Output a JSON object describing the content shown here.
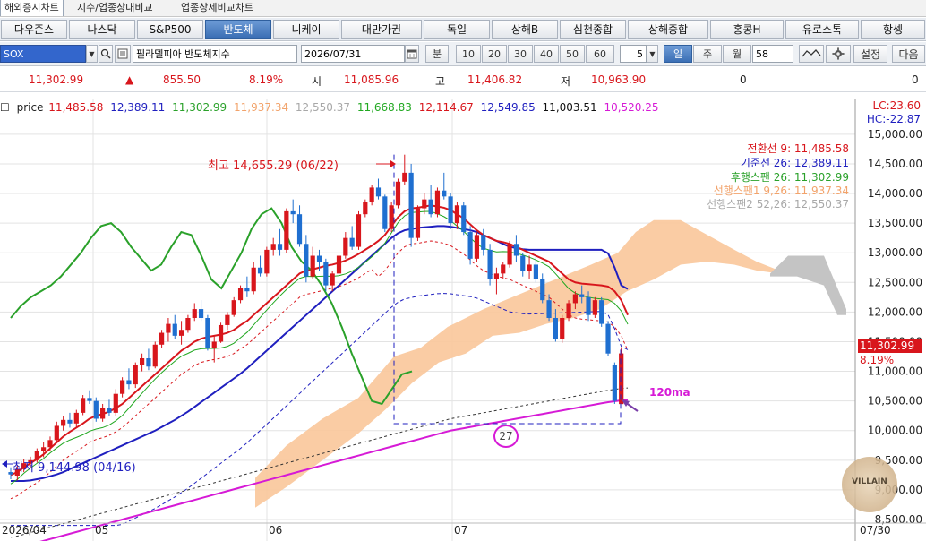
{
  "top_tabs": [
    "해외증시차트",
    "지수/업종상대비교",
    "업종상세비교차트"
  ],
  "markets": [
    "다우존스",
    "나스닥",
    "S&P500",
    "반도체",
    "니케이",
    "대만가권",
    "독일",
    "상해B",
    "심천종합",
    "상해종합",
    "홍콩H",
    "유로스톡",
    "항셍"
  ],
  "active_market": "반도체",
  "controls": {
    "code": "SOX",
    "name": "필라델피아 반도체지수",
    "date": "2026/07/31",
    "period_label": "분",
    "minute_options": [
      "10",
      "20",
      "30",
      "40",
      "50",
      "60"
    ],
    "minute_select": "5",
    "day_label": "일",
    "week_label": "주",
    "month_label": "월",
    "count_value": "58",
    "settings_label": "설정",
    "next_label": "다음"
  },
  "price_row": {
    "current": "11,302.99",
    "arrow": "▲",
    "change": "855.50",
    "change_pct": "8.19%",
    "open_label": "시",
    "open": "11,085.96",
    "high_label": "고",
    "high": "11,406.82",
    "low_label": "저",
    "low": "10,963.90",
    "vol1": "0",
    "vol2": "0"
  },
  "legend": {
    "label": "price",
    "values": [
      "11,485.58",
      "12,389.11",
      "11,302.99",
      "11,937.34",
      "12,550.37",
      "11,668.83",
      "12,114.67",
      "12,549.85",
      "11,003.51",
      "10,520.25"
    ],
    "colors": [
      "#d8161c",
      "#1f1fbf",
      "#2aa12a",
      "#f2a36b",
      "#a8a8a8",
      "#21a821",
      "#d8161c",
      "#1f1fbf",
      "#111111",
      "#d61ad6"
    ]
  },
  "lc_hc": {
    "lc": "LC:23.60",
    "hc": "HC:-22.87"
  },
  "ichimoku_labels": [
    {
      "text": "전환선 9: 11,485.58",
      "color": "#d8161c"
    },
    {
      "text": "기준선 26: 12,389.11",
      "color": "#1f1fbf"
    },
    {
      "text": "후행스팬 26: 11,302.99",
      "color": "#2aa12a"
    },
    {
      "text": "선행스팬1 9,26: 11,937.34",
      "color": "#f2a36b"
    },
    {
      "text": "선행스팬2 52,26: 12,550.37",
      "color": "#a8a8a8"
    }
  ],
  "annotations": {
    "high": "최고 14,655.29 (06/22)",
    "low": "최저 9,144.98 (04/16)",
    "count": "27",
    "ma": "120ma",
    "watermark": "VILLAIN"
  },
  "current_price_tag": {
    "price": "11,302.99",
    "pct": "8.19%"
  },
  "chart_data": {
    "type": "candlestick",
    "y_axis": {
      "ticks": [
        "15,000.00",
        "14,500.00",
        "14,000.00",
        "13,500.00",
        "13,000.00",
        "12,500.00",
        "12,000.00",
        "11,500.00",
        "11,000.00",
        "10,500.00",
        "10,000.00",
        "9,500.00",
        "9,000.00",
        "8,500.00"
      ],
      "range": [
        8500,
        15300
      ]
    },
    "x_axis": {
      "labels": [
        "2026/04",
        "05",
        "06",
        "07",
        "07/30"
      ]
    },
    "candles": [
      [
        9300,
        9380,
        9180,
        9260
      ],
      [
        9240,
        9420,
        9160,
        9350
      ],
      [
        9350,
        9520,
        9300,
        9450
      ],
      [
        9450,
        9560,
        9380,
        9500
      ],
      [
        9500,
        9700,
        9460,
        9650
      ],
      [
        9650,
        9800,
        9550,
        9720
      ],
      [
        9720,
        9900,
        9650,
        9840
      ],
      [
        9840,
        10150,
        9800,
        10080
      ],
      [
        10080,
        10250,
        10000,
        10180
      ],
      [
        10180,
        10300,
        10050,
        10120
      ],
      [
        10120,
        10350,
        10050,
        10300
      ],
      [
        10300,
        10600,
        10260,
        10550
      ],
      [
        10550,
        10680,
        10450,
        10500
      ],
      [
        10500,
        10560,
        10150,
        10200
      ],
      [
        10200,
        10450,
        10150,
        10380
      ],
      [
        10380,
        10520,
        10250,
        10300
      ],
      [
        10300,
        10700,
        10250,
        10620
      ],
      [
        10620,
        10900,
        10560,
        10850
      ],
      [
        10850,
        11050,
        10700,
        10780
      ],
      [
        10780,
        11150,
        10720,
        11100
      ],
      [
        11100,
        11300,
        11000,
        11220
      ],
      [
        11220,
        11380,
        11020,
        11080
      ],
      [
        11080,
        11500,
        11050,
        11450
      ],
      [
        11450,
        11700,
        11400,
        11650
      ],
      [
        11650,
        11900,
        11500,
        11800
      ],
      [
        11800,
        11950,
        11550,
        11600
      ],
      [
        11600,
        11850,
        11450,
        11700
      ],
      [
        11700,
        11950,
        11650,
        11900
      ],
      [
        11900,
        12150,
        11850,
        12050
      ],
      [
        12050,
        12200,
        11850,
        11900
      ],
      [
        11900,
        11950,
        11350,
        11400
      ],
      [
        11400,
        11600,
        11150,
        11500
      ],
      [
        11500,
        11820,
        11480,
        11780
      ],
      [
        11780,
        12000,
        11700,
        11950
      ],
      [
        11950,
        12250,
        11920,
        12200
      ],
      [
        12200,
        12450,
        12150,
        12400
      ],
      [
        12400,
        12600,
        12250,
        12350
      ],
      [
        12350,
        12850,
        12300,
        12750
      ],
      [
        12750,
        12950,
        12600,
        12650
      ],
      [
        12650,
        13100,
        12600,
        13050
      ],
      [
        13050,
        13250,
        12950,
        13150
      ],
      [
        13150,
        13400,
        12950,
        13050
      ],
      [
        13050,
        13750,
        13000,
        13700
      ],
      [
        13700,
        13900,
        13500,
        13650
      ],
      [
        13650,
        13800,
        13100,
        13150
      ],
      [
        13150,
        13300,
        12500,
        12600
      ],
      [
        12600,
        13100,
        12550,
        12950
      ],
      [
        12950,
        13050,
        12700,
        12850
      ],
      [
        12850,
        12900,
        12350,
        12450
      ],
      [
        12450,
        12700,
        12350,
        12650
      ],
      [
        12650,
        13050,
        12600,
        12950
      ],
      [
        12950,
        13350,
        12900,
        13250
      ],
      [
        13250,
        13450,
        13050,
        13100
      ],
      [
        13100,
        13700,
        13050,
        13650
      ],
      [
        13650,
        13900,
        13600,
        13850
      ],
      [
        13850,
        14150,
        13800,
        14100
      ],
      [
        14100,
        14250,
        13900,
        13950
      ],
      [
        13950,
        13980,
        13350,
        13400
      ],
      [
        13400,
        13850,
        13350,
        13800
      ],
      [
        13800,
        14250,
        13750,
        14200
      ],
      [
        14200,
        14655,
        14150,
        14350
      ],
      [
        14350,
        14500,
        13100,
        13250
      ],
      [
        13250,
        13800,
        13200,
        13750
      ],
      [
        13750,
        14000,
        13650,
        13900
      ],
      [
        13900,
        14150,
        13600,
        13650
      ],
      [
        13650,
        14100,
        13600,
        14050
      ],
      [
        14050,
        14350,
        13900,
        13950
      ],
      [
        13950,
        14000,
        13400,
        13500
      ],
      [
        13500,
        13850,
        13400,
        13800
      ],
      [
        13800,
        13850,
        13300,
        13350
      ],
      [
        13350,
        13450,
        12800,
        12900
      ],
      [
        12900,
        13350,
        12850,
        13300
      ],
      [
        13300,
        13400,
        12950,
        13050
      ],
      [
        13050,
        13150,
        12450,
        12550
      ],
      [
        12550,
        12750,
        12300,
        12650
      ],
      [
        12650,
        12850,
        12550,
        12800
      ],
      [
        12800,
        13200,
        12750,
        13150
      ],
      [
        13150,
        13300,
        12850,
        12950
      ],
      [
        12950,
        13000,
        12600,
        12700
      ],
      [
        12700,
        12950,
        12550,
        12800
      ],
      [
        12800,
        12950,
        12500,
        12550
      ],
      [
        12550,
        12650,
        12150,
        12200
      ],
      [
        12200,
        12300,
        11850,
        11900
      ],
      [
        11900,
        12050,
        11500,
        11550
      ],
      [
        11550,
        11950,
        11480,
        11900
      ],
      [
        11900,
        12200,
        11850,
        12150
      ],
      [
        12150,
        12350,
        12050,
        12300
      ],
      [
        12300,
        12450,
        12150,
        12250
      ],
      [
        12250,
        12350,
        11850,
        11950
      ],
      [
        11950,
        12250,
        11900,
        12200
      ],
      [
        12200,
        12250,
        11750,
        11800
      ],
      [
        11800,
        11850,
        11250,
        11300
      ],
      [
        11100,
        11150,
        10450,
        10500
      ],
      [
        10447,
        11406,
        10963,
        11302
      ]
    ],
    "series": [
      {
        "name": "전환선 9",
        "color": "#d8161c",
        "values": [
          9250,
          9300,
          9380,
          9450,
          9520,
          9600,
          9700,
          9800,
          9900,
          9980,
          10050,
          10120,
          10200,
          10250,
          10280,
          10320,
          10380,
          10450,
          10550,
          10650,
          10750,
          10850,
          10950,
          11050,
          11150,
          11250,
          11350,
          11420,
          11500,
          11550,
          11580,
          11600,
          11620,
          11650,
          11700,
          11780,
          11850,
          11950,
          12050,
          12150,
          12250,
          12350,
          12450,
          12550,
          12650,
          12700,
          12720,
          12750,
          12780,
          12800,
          12830,
          12870,
          12920,
          12980,
          13050,
          13120,
          13200,
          13300,
          13450,
          13600,
          13700,
          13750,
          13760,
          13780,
          13800,
          13780,
          13760,
          13720,
          13650,
          13580,
          13480,
          13380,
          13300,
          13250,
          13200,
          13180,
          13150,
          13100,
          13050,
          13000,
          12950,
          12900,
          12850,
          12750,
          12650,
          12550,
          12500,
          12480,
          12470,
          12460,
          12450,
          12430,
          12350,
          12200,
          11950
        ]
      },
      {
        "name": "기준선 26",
        "color": "#1f1fbf",
        "values": [
          9150,
          9150,
          9150,
          9160,
          9180,
          9200,
          9230,
          9260,
          9300,
          9350,
          9400,
          9450,
          9500,
          9550,
          9600,
          9650,
          9700,
          9750,
          9800,
          9850,
          9900,
          9950,
          10000,
          10060,
          10120,
          10180,
          10250,
          10320,
          10400,
          10480,
          10560,
          10640,
          10720,
          10800,
          10880,
          10960,
          11050,
          11150,
          11250,
          11350,
          11450,
          11550,
          11650,
          11750,
          11850,
          11950,
          12050,
          12150,
          12250,
          12350,
          12450,
          12550,
          12650,
          12750,
          12850,
          12950,
          13050,
          13150,
          13250,
          13330,
          13380,
          13400,
          13420,
          13430,
          13440,
          13450,
          13450,
          13440,
          13420,
          13400,
          13380,
          13350,
          13300,
          13250,
          13200,
          13150,
          13100,
          13080,
          13060,
          13050,
          13050,
          13050,
          13050,
          13050,
          13050,
          13050,
          13050,
          13050,
          13050,
          13050,
          13050,
          12990,
          12750,
          12450,
          12389
        ]
      },
      {
        "name": "후행스팬 26",
        "color": "#2aa12a",
        "values": [
          11900,
          12100,
          12250,
          12350,
          12450,
          12600,
          12800,
          13000,
          13250,
          13450,
          13500,
          13350,
          13100,
          12900,
          12700,
          12800,
          13100,
          13350,
          13300,
          12950,
          12550,
          12400,
          12700,
          13000,
          13400,
          13650,
          13750,
          13500,
          13100,
          12850,
          12700,
          12450,
          12150,
          11750,
          11300,
          10900,
          10500,
          10450,
          10700,
          10950,
          11000
        ]
      },
      {
        "name": "120ma",
        "color": "#d61ad6",
        "values": [
          8000,
          8020,
          8050,
          8080,
          8110,
          8140,
          8170,
          8200,
          8230,
          8260,
          8290,
          8320,
          8350,
          8380,
          8410,
          8440,
          8470,
          8500,
          8530,
          8560,
          8590,
          8620,
          8650,
          8680,
          8710,
          8740,
          8770,
          8800,
          8830,
          8860,
          8890,
          8920,
          8950,
          8980,
          9010,
          9040,
          9070,
          9100,
          9130,
          9160,
          9190,
          9220,
          9250,
          9280,
          9310,
          9340,
          9370,
          9400,
          9430,
          9460,
          9490,
          9520,
          9550,
          9580,
          9610,
          9640,
          9670,
          9700,
          9730,
          9760,
          9790,
          9820,
          9850,
          9880,
          9910,
          9940,
          9970,
          10000,
          10020,
          10040,
          10060,
          10080,
          10100,
          10120,
          10140,
          10160,
          10180,
          10200,
          10220,
          10240,
          10260,
          10280,
          10300,
          10320,
          10340,
          10360,
          10380,
          10400,
          10420,
          10440,
          10460,
          10480,
          10495,
          10510,
          10520
        ]
      }
    ]
  }
}
